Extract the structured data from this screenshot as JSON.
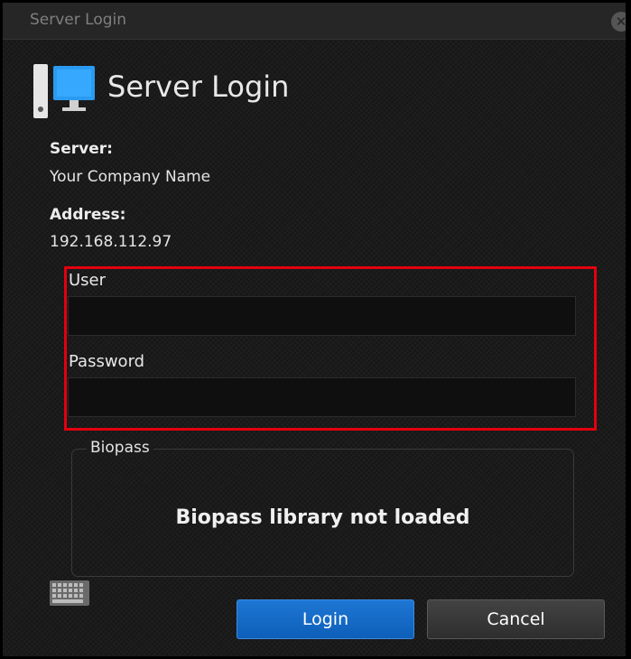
{
  "window": {
    "title": "Server Login"
  },
  "header": {
    "title": "Server Login",
    "icon": "server-computer-icon"
  },
  "server": {
    "label": "Server:",
    "value": "Your Company Name"
  },
  "address": {
    "label": "Address:",
    "value": "192.168.112.97"
  },
  "form": {
    "user_label": "User",
    "user_value": "",
    "password_label": "Password",
    "password_value": ""
  },
  "biopass": {
    "legend": "Biopass",
    "status": "Biopass library not loaded"
  },
  "buttons": {
    "login": "Login",
    "cancel": "Cancel",
    "keyboard_icon": "keyboard-icon"
  },
  "colors": {
    "accent_blue": "#1068c8",
    "highlight_red": "#e3000f",
    "background": "#1b1b1b"
  }
}
